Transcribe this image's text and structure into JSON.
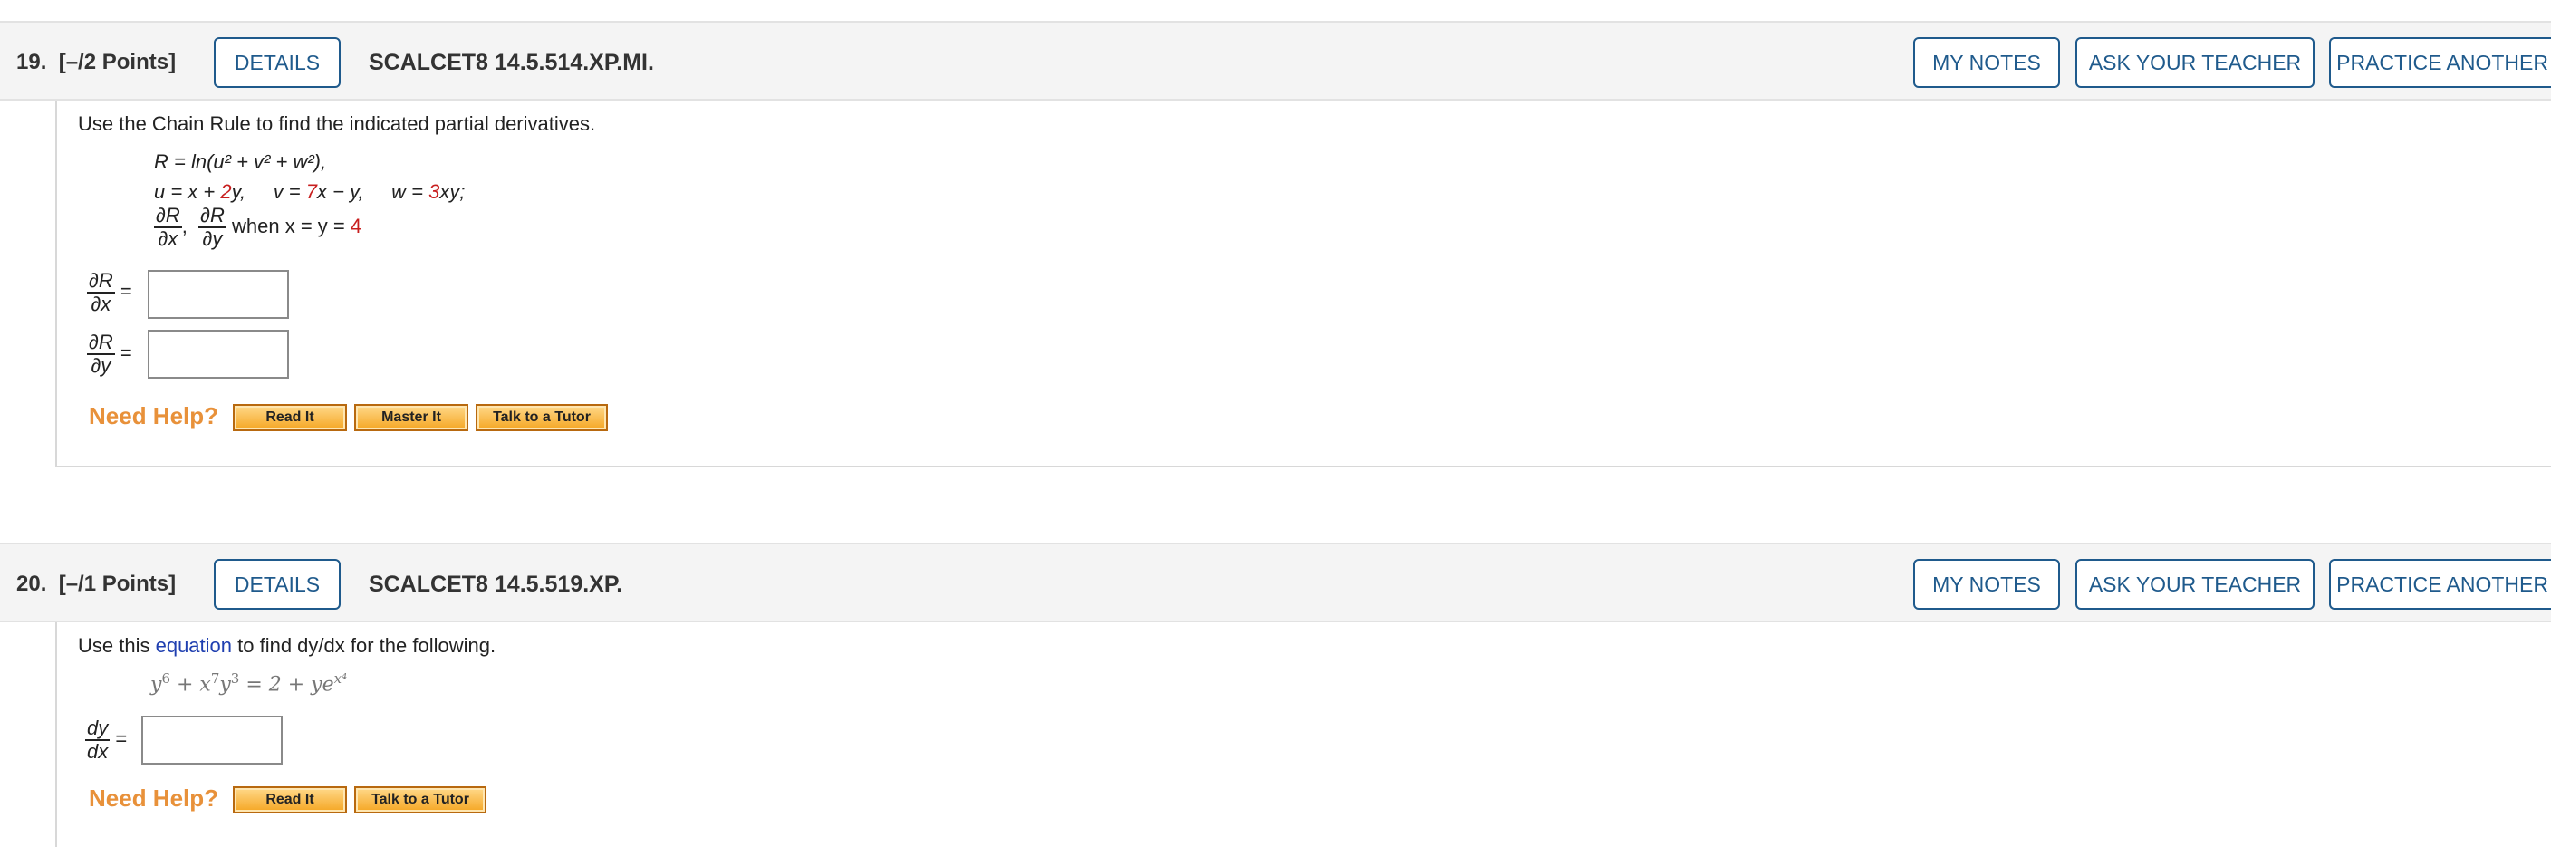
{
  "questions": [
    {
      "number": "19.",
      "points": "[–/2 Points]",
      "details_label": "DETAILS",
      "code": "SCALCET8 14.5.514.XP.MI.",
      "my_notes_label": "MY NOTES",
      "ask_teacher_label": "ASK YOUR TEACHER",
      "practice_label": "PRACTICE ANOTHER",
      "prompt": "Use the Chain Rule to find the indicated partial derivatives.",
      "line1": "R = ln(u² + v² + w²),",
      "line2_u": "u = x + ",
      "line2_u_coef": "2",
      "line2_u_end": "y,",
      "line2_v": "v = ",
      "line2_v_coef": "7",
      "line2_v_end": "x − y,",
      "line2_w": "w = ",
      "line2_w_coef": "3",
      "line2_w_end": "xy;",
      "partials_num": "∂R",
      "partials_den_x": "∂x",
      "partials_den_y": "∂y",
      "when_text": "when x = y = ",
      "when_value": "4",
      "answer1_num": "∂R",
      "answer1_den": "∂x",
      "answer2_num": "∂R",
      "answer2_den": "∂y",
      "equals": "=",
      "need_help": "Need Help?",
      "help_buttons": [
        "Read It",
        "Master It",
        "Talk to a Tutor"
      ]
    },
    {
      "number": "20.",
      "points": "[–/1 Points]",
      "details_label": "DETAILS",
      "code": "SCALCET8 14.5.519.XP.",
      "my_notes_label": "MY NOTES",
      "ask_teacher_label": "ASK YOUR TEACHER",
      "practice_label": "PRACTICE ANOTHER",
      "prompt_pre": "Use this ",
      "prompt_link": "equation",
      "prompt_post": " to find dy/dx for the following.",
      "eq_left": "y",
      "eq_left_exp": "6",
      "eq_plus": " + x",
      "eq_x_exp": "7",
      "eq_y": "y",
      "eq_y_exp": "3",
      "eq_rhs": " = 2 + ye",
      "eq_rhs_exp": "x⁴",
      "answer_num": "dy",
      "answer_den": "dx",
      "equals": "=",
      "need_help": "Need Help?",
      "help_buttons": [
        "Read It",
        "Talk to a Tutor"
      ]
    }
  ]
}
